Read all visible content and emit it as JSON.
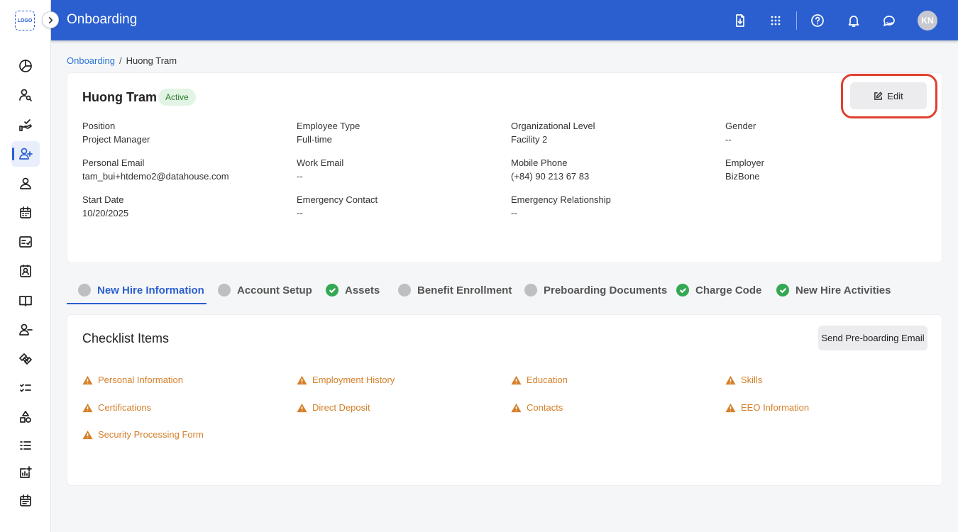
{
  "app": {
    "logo_text": "LOGO",
    "title": "Onboarding",
    "avatar_initials": "KN"
  },
  "breadcrumb": {
    "root": "Onboarding",
    "separator": "/",
    "current": "Huong Tram"
  },
  "profile": {
    "name": "Huong Tram",
    "status": "Active",
    "edit_label": "Edit",
    "fields": [
      {
        "label": "Position",
        "value": "Project Manager"
      },
      {
        "label": "Employee Type",
        "value": "Full-time"
      },
      {
        "label": "Organizational Level",
        "value": "Facility 2"
      },
      {
        "label": "Gender",
        "value": "--"
      },
      {
        "label": "Personal Email",
        "value": "tam_bui+htdemo2@datahouse.com"
      },
      {
        "label": "Work Email",
        "value": "--"
      },
      {
        "label": "Mobile Phone",
        "value": "(+84) 90 213 67 83"
      },
      {
        "label": "Employer",
        "value": "BizBone"
      },
      {
        "label": "Start Date",
        "value": "10/20/2025"
      },
      {
        "label": "Emergency Contact",
        "value": "--"
      },
      {
        "label": "Emergency Relationship",
        "value": "--"
      }
    ]
  },
  "tabs": [
    {
      "label": "New Hire Information",
      "state": "pending",
      "active": true
    },
    {
      "label": "Account Setup",
      "state": "pending",
      "active": false
    },
    {
      "label": "Assets",
      "state": "complete",
      "active": false
    },
    {
      "label": "Benefit Enrollment",
      "state": "pending",
      "active": false
    },
    {
      "label": "Preboarding Documents",
      "state": "pending",
      "active": false
    },
    {
      "label": "Charge Code",
      "state": "complete",
      "active": false
    },
    {
      "label": "New Hire Activities",
      "state": "complete",
      "active": false
    }
  ],
  "checklist": {
    "title": "Checklist Items",
    "send_button": "Send Pre-boarding Email",
    "items": [
      "Personal Information",
      "Employment History",
      "Education",
      "Skills",
      "Certifications",
      "Direct Deposit",
      "Contacts",
      "EEO Information",
      "Security Processing Form"
    ]
  },
  "colors": {
    "brand": "#2b5fd0",
    "warning": "#d5802a",
    "success": "#34a853",
    "highlight": "#e0402f"
  },
  "icons": {
    "sidebar": [
      "dashboard-icon",
      "user-search-icon",
      "hand-check-icon",
      "user-add-icon",
      "user-icon",
      "calendar-icon",
      "checklist-form-icon",
      "contact-card-icon",
      "book-icon",
      "user-remove-icon",
      "handshake-icon",
      "task-list-icon",
      "shapes-icon",
      "list-check-icon",
      "report-add-icon",
      "calendar-event-icon"
    ],
    "header": [
      "download-doc-icon",
      "apps-grid-icon",
      "help-icon",
      "bell-icon",
      "chat-icon"
    ]
  }
}
